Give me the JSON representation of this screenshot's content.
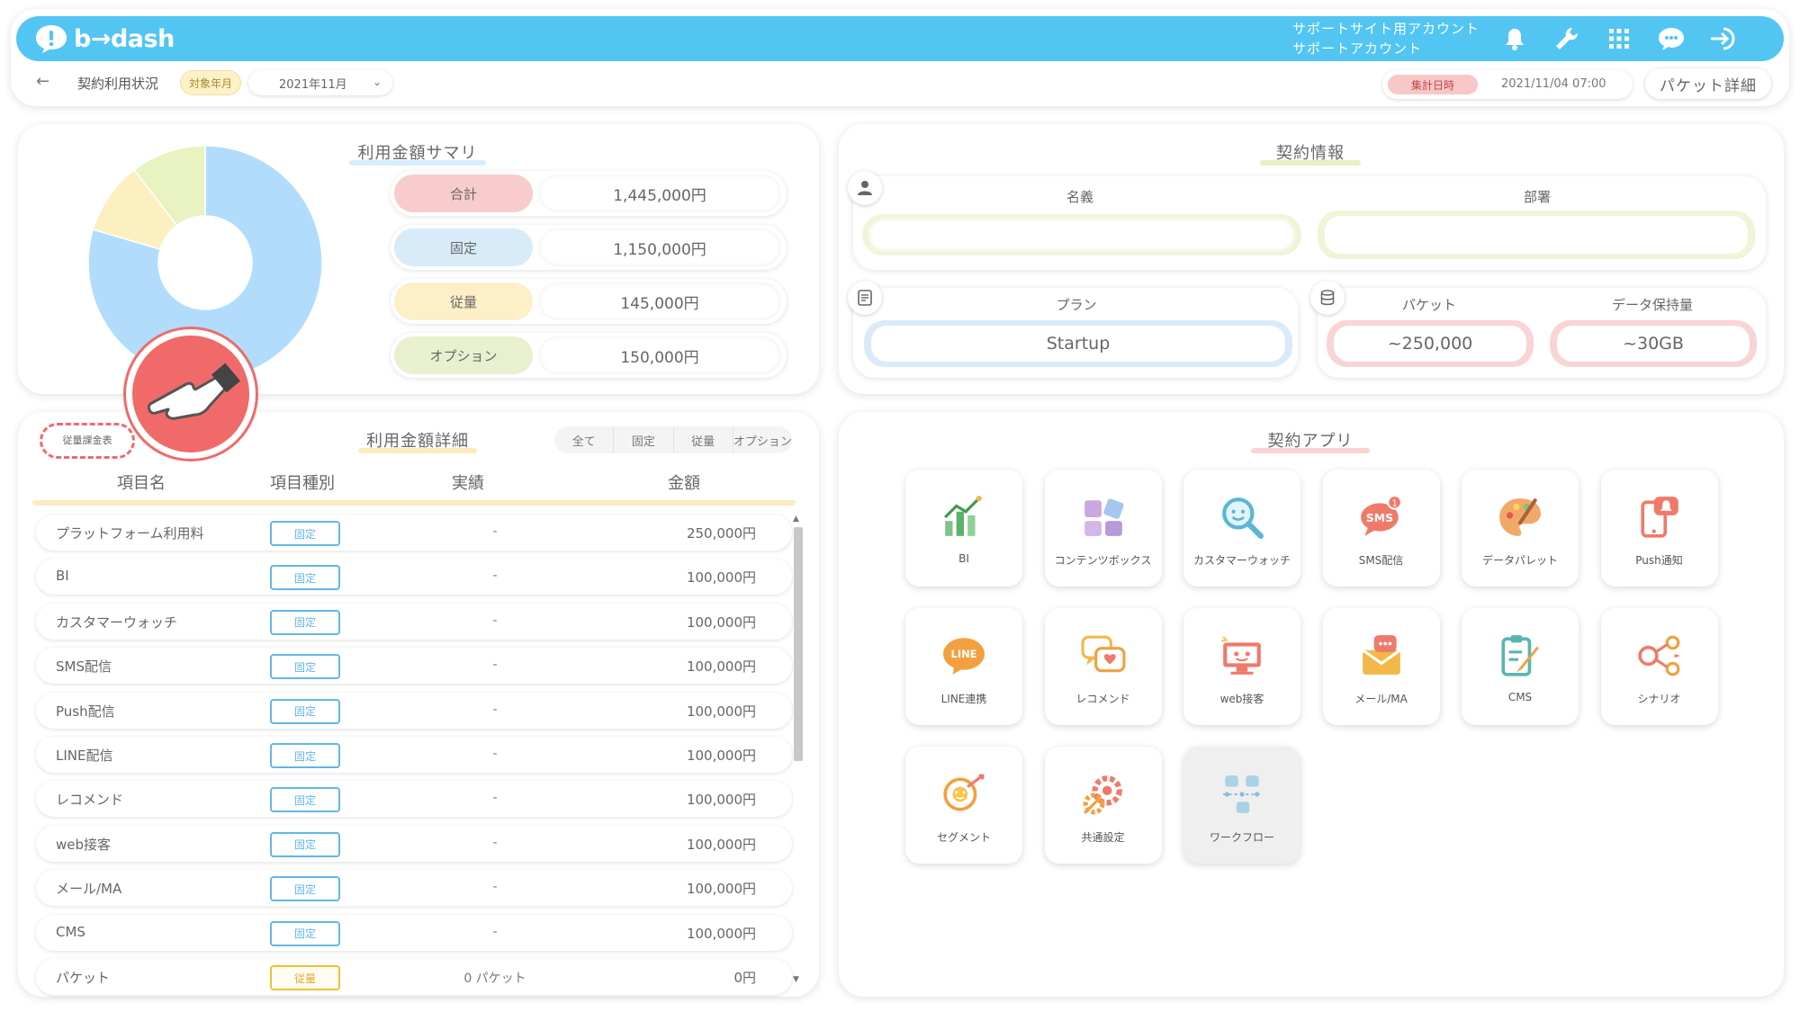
{
  "header": {
    "logo_text": "b→dash",
    "account_line1": "サポートサイト用アカウント",
    "account_line2": "サポートアカウント",
    "icons": [
      "bell-icon",
      "wrench-icon",
      "grid-icon",
      "chat-icon",
      "logout-icon"
    ]
  },
  "subheader": {
    "back_icon": "←",
    "title": "契約利用状況",
    "period_tag": "対象年月",
    "month": "2021年11月",
    "aggregate_label": "集計日時",
    "aggregate_value": "2021/11/04 07:00",
    "packet_detail_button": "パケット詳細"
  },
  "summary": {
    "title": "利用金額サマリ",
    "rows": [
      {
        "label": "合計",
        "amount": "1,445,000円"
      },
      {
        "label": "固定",
        "amount": "1,150,000円"
      },
      {
        "label": "従量",
        "amount": "145,000円"
      },
      {
        "label": "オプション",
        "amount": "150,000円"
      }
    ],
    "donut": [
      {
        "label": "固定",
        "value": 1150000,
        "color": "#b2dcfb"
      },
      {
        "label": "従量",
        "value": 145000,
        "color": "#fdf0c0"
      },
      {
        "label": "オプション",
        "value": 150000,
        "color": "#e9f3c2"
      }
    ]
  },
  "detail": {
    "title": "利用金額詳細",
    "tariff_link": "従量課金表",
    "filters": [
      "全て",
      "固定",
      "従量",
      "オプション"
    ],
    "columns": [
      "項目名",
      "項目種別",
      "実績",
      "金額"
    ],
    "rows": [
      {
        "name": "プラットフォーム利用料",
        "type": "固定",
        "result": "-",
        "amount": "250,000円"
      },
      {
        "name": "BI",
        "type": "固定",
        "result": "-",
        "amount": "100,000円"
      },
      {
        "name": "カスタマーウォッチ",
        "type": "固定",
        "result": "-",
        "amount": "100,000円"
      },
      {
        "name": "SMS配信",
        "type": "固定",
        "result": "-",
        "amount": "100,000円"
      },
      {
        "name": "Push配信",
        "type": "固定",
        "result": "-",
        "amount": "100,000円"
      },
      {
        "name": "LINE配信",
        "type": "固定",
        "result": "-",
        "amount": "100,000円"
      },
      {
        "name": "レコメンド",
        "type": "固定",
        "result": "-",
        "amount": "100,000円"
      },
      {
        "name": "web接客",
        "type": "固定",
        "result": "-",
        "amount": "100,000円"
      },
      {
        "name": "メール/MA",
        "type": "固定",
        "result": "-",
        "amount": "100,000円"
      },
      {
        "name": "CMS",
        "type": "固定",
        "result": "-",
        "amount": "100,000円"
      },
      {
        "name": "パケット",
        "type": "従量",
        "result": "0 パケット",
        "amount": "0円"
      }
    ]
  },
  "contract": {
    "title": "契約情報",
    "name_label": "名義",
    "name_value": "",
    "dept_label": "部署",
    "dept_value": "",
    "plan_label": "プラン",
    "plan_value": "Startup",
    "packet_label": "パケット",
    "packet_value": "~250,000",
    "retention_label": "データ保持量",
    "retention_value": "~30GB"
  },
  "apps": {
    "title": "契約アプリ",
    "items": [
      {
        "label": "BI",
        "icon": "bi-chart-icon"
      },
      {
        "label": "コンテンツボックス",
        "icon": "contents-box-icon"
      },
      {
        "label": "カスタマーウォッチ",
        "icon": "magnifier-face-icon"
      },
      {
        "label": "SMS配信",
        "icon": "sms-bubble-icon"
      },
      {
        "label": "データパレット",
        "icon": "palette-icon"
      },
      {
        "label": "Push通知",
        "icon": "push-phone-icon"
      },
      {
        "label": "LINE連携",
        "icon": "line-bubble-icon"
      },
      {
        "label": "レコメンド",
        "icon": "recommend-bubble-icon"
      },
      {
        "label": "web接客",
        "icon": "web-monitor-icon"
      },
      {
        "label": "メール/MA",
        "icon": "mail-envelope-icon"
      },
      {
        "label": "CMS",
        "icon": "cms-clipboard-icon"
      },
      {
        "label": "シナリオ",
        "icon": "scenario-nodes-icon"
      },
      {
        "label": "セグメント",
        "icon": "segment-target-icon"
      },
      {
        "label": "共通設定",
        "icon": "settings-gears-icon"
      },
      {
        "label": "ワークフロー",
        "icon": "workflow-nodes-icon"
      }
    ]
  },
  "colors": {
    "header_blue": "#52c5f3",
    "fixed_blue": "#63b6e9",
    "metered_yellow": "#f0c030",
    "pointer_red": "#f06a6a"
  }
}
